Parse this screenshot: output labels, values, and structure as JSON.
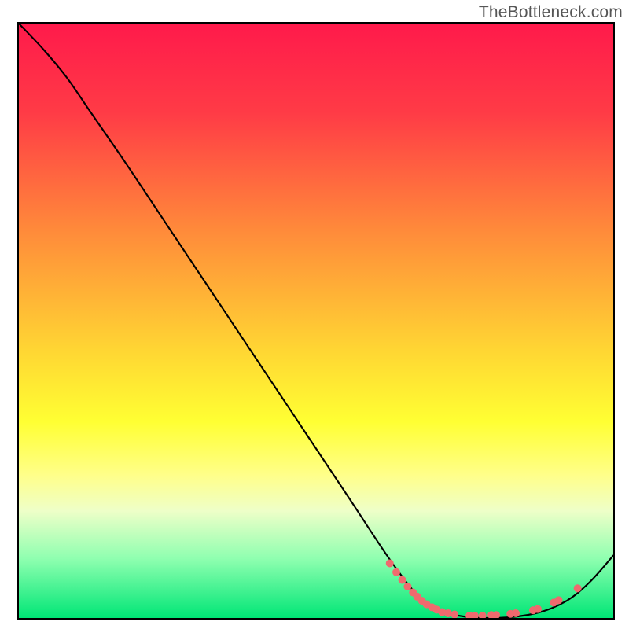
{
  "watermark": "TheBottleneck.com",
  "chart_data": {
    "type": "line",
    "title": "",
    "xlabel": "",
    "ylabel": "",
    "xlim": [
      0,
      100
    ],
    "ylim": [
      0,
      100
    ],
    "gradient_stops": [
      {
        "offset": 0,
        "color": "#ff1a4b"
      },
      {
        "offset": 15,
        "color": "#ff3b46"
      },
      {
        "offset": 35,
        "color": "#ff8b3a"
      },
      {
        "offset": 55,
        "color": "#ffd633"
      },
      {
        "offset": 67,
        "color": "#ffff33"
      },
      {
        "offset": 76,
        "color": "#ffff8a"
      },
      {
        "offset": 82,
        "color": "#eeffc8"
      },
      {
        "offset": 90,
        "color": "#8fffb0"
      },
      {
        "offset": 100,
        "color": "#00e676"
      }
    ],
    "curve": [
      {
        "x": 0.0,
        "y": 100.0
      },
      {
        "x": 4.0,
        "y": 95.8
      },
      {
        "x": 8.0,
        "y": 91.0
      },
      {
        "x": 12.0,
        "y": 85.2
      },
      {
        "x": 18.0,
        "y": 76.5
      },
      {
        "x": 25.0,
        "y": 66.0
      },
      {
        "x": 35.0,
        "y": 51.0
      },
      {
        "x": 45.0,
        "y": 36.0
      },
      {
        "x": 55.0,
        "y": 21.0
      },
      {
        "x": 63.0,
        "y": 9.0
      },
      {
        "x": 68.0,
        "y": 3.0
      },
      {
        "x": 73.0,
        "y": 0.6
      },
      {
        "x": 80.0,
        "y": 0.0
      },
      {
        "x": 87.0,
        "y": 0.8
      },
      {
        "x": 92.0,
        "y": 2.8
      },
      {
        "x": 96.0,
        "y": 6.0
      },
      {
        "x": 100.0,
        "y": 10.5
      }
    ],
    "scatter": [
      {
        "x": 62.4,
        "y": 9.2
      },
      {
        "x": 63.5,
        "y": 7.7
      },
      {
        "x": 64.5,
        "y": 6.4
      },
      {
        "x": 65.4,
        "y": 5.3
      },
      {
        "x": 66.3,
        "y": 4.3
      },
      {
        "x": 67.0,
        "y": 3.6
      },
      {
        "x": 67.8,
        "y": 2.9
      },
      {
        "x": 68.6,
        "y": 2.3
      },
      {
        "x": 69.5,
        "y": 1.8
      },
      {
        "x": 70.3,
        "y": 1.4
      },
      {
        "x": 71.2,
        "y": 1.0
      },
      {
        "x": 72.2,
        "y": 0.8
      },
      {
        "x": 73.3,
        "y": 0.6
      },
      {
        "x": 75.8,
        "y": 0.4
      },
      {
        "x": 76.7,
        "y": 0.4
      },
      {
        "x": 78.0,
        "y": 0.4
      },
      {
        "x": 79.5,
        "y": 0.5
      },
      {
        "x": 80.3,
        "y": 0.5
      },
      {
        "x": 82.7,
        "y": 0.7
      },
      {
        "x": 83.6,
        "y": 0.8
      },
      {
        "x": 86.5,
        "y": 1.3
      },
      {
        "x": 87.3,
        "y": 1.5
      },
      {
        "x": 90.0,
        "y": 2.6
      },
      {
        "x": 90.8,
        "y": 3.0
      },
      {
        "x": 94.0,
        "y": 5.0
      }
    ],
    "scatter_color": "#ef6a6e",
    "scatter_radius": 5
  }
}
